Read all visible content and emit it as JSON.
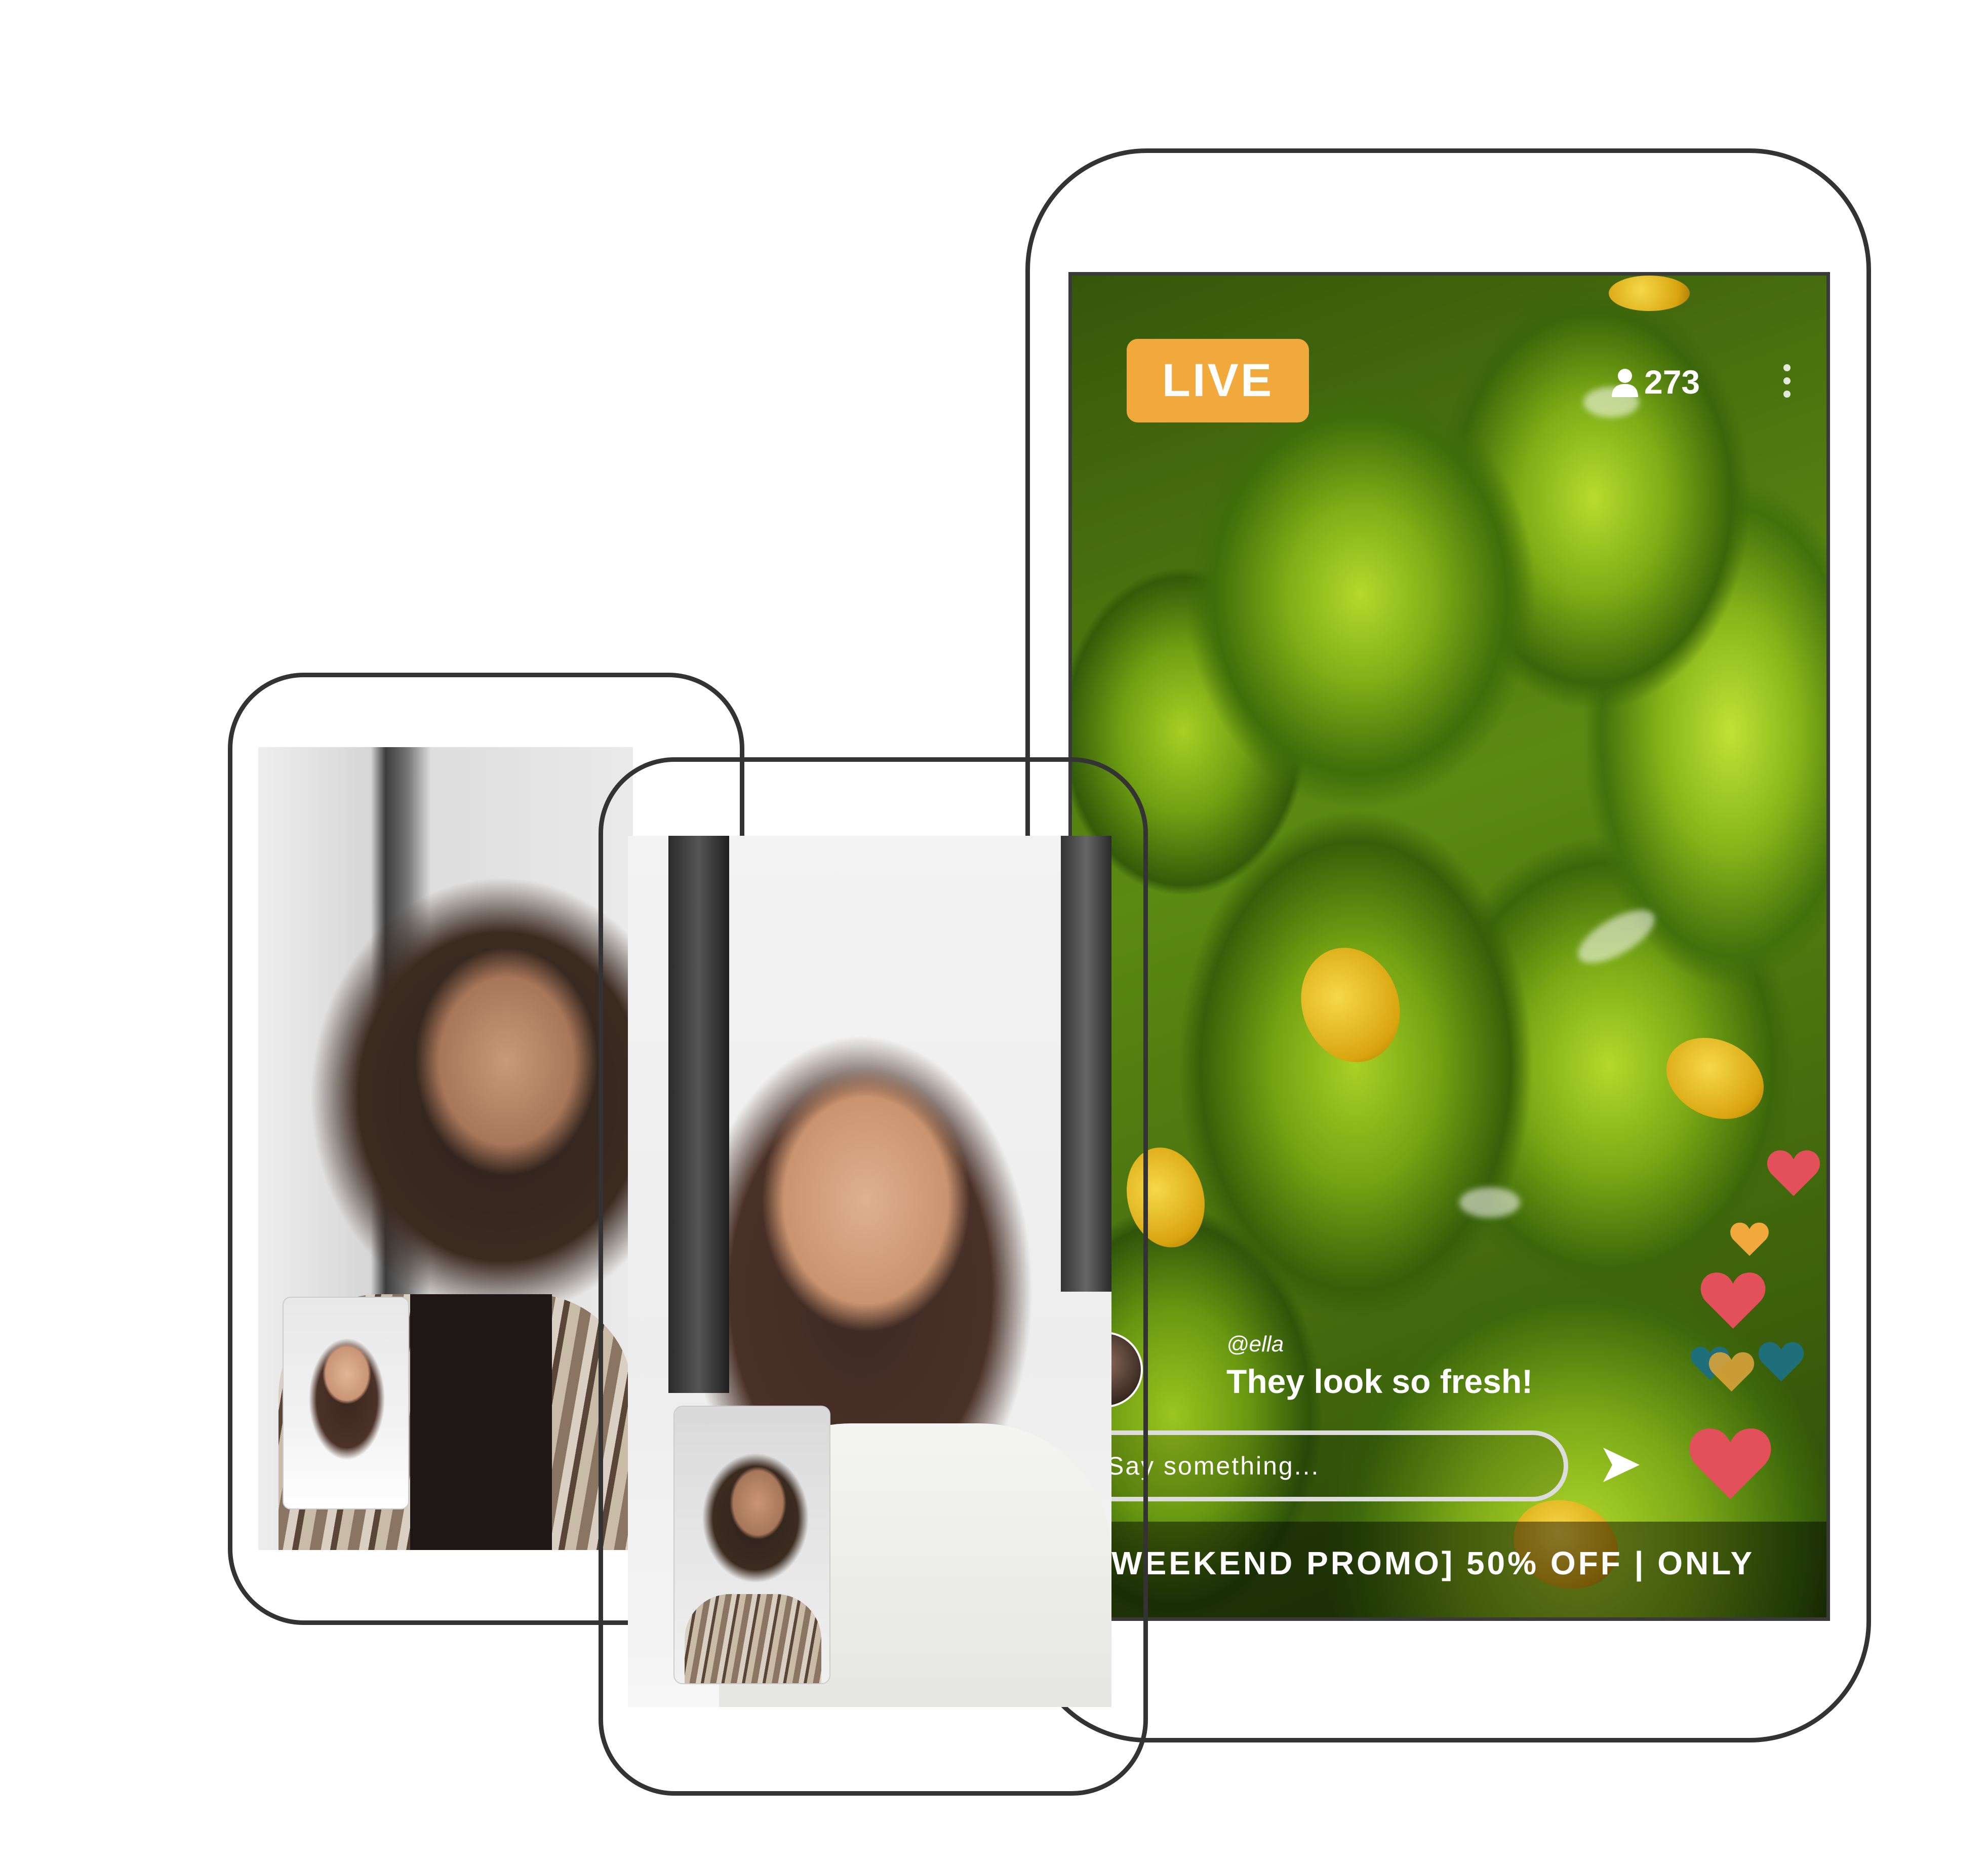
{
  "live_stream": {
    "badge": "LIVE",
    "viewer_count": "273",
    "comment": {
      "user": "@ella",
      "text": "They look so fresh!"
    },
    "input_placeholder": "Say something...",
    "promo_banner": "VE WEEKEND PROMO] 50% OFF | ONLY"
  },
  "colors": {
    "live_badge": "#f0a93a",
    "heart_red": "#e2505a",
    "heart_yellow": "#f0a93a",
    "heart_teal": "#1f6f7a",
    "phone_outline": "#333333"
  },
  "icons": [
    "person-icon",
    "more-icon",
    "send-icon",
    "heart-icon"
  ]
}
